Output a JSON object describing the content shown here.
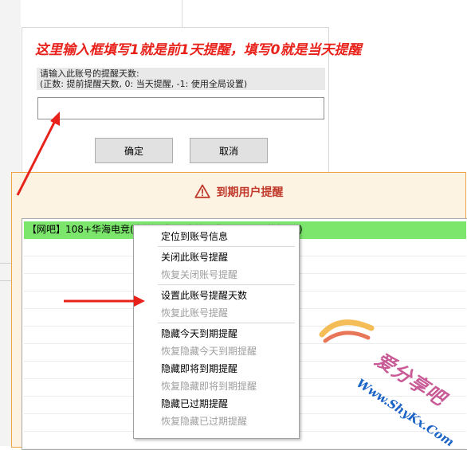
{
  "annotation": {
    "text": "这里输入框填写1就是前1天提醒，填写0就是当天提醒"
  },
  "input_dialog": {
    "prompt_line1": "请输入此账号的提醒天数:",
    "prompt_line2": "(正数: 提前提醒天数, 0: 当天提醒, -1: 使用全局设置)",
    "input_value": "",
    "ok_label": "确定",
    "cancel_label": "取消"
  },
  "expiry_window": {
    "title": "到期用户提醒",
    "warning_icon": "warning-triangle-icon",
    "title_color": "#c0392b",
    "rows": [
      {
        "text": "【网吧】108+华海电竞(电信网费)，电信网费2600元 (剩余1天)",
        "selected": true,
        "highlight_color": "#7be56c"
      }
    ]
  },
  "context_menu": {
    "groups": [
      [
        {
          "label": "定位到账号信息",
          "enabled": true
        }
      ],
      [
        {
          "label": "关闭此账号提醒",
          "enabled": true
        },
        {
          "label": "恢复关闭账号提醒",
          "enabled": false
        }
      ],
      [
        {
          "label": "设置此账号提醒天数",
          "enabled": true
        },
        {
          "label": "恢复此账号提醒",
          "enabled": false
        }
      ],
      [
        {
          "label": "隐藏今天到期提醒",
          "enabled": true
        },
        {
          "label": "恢复隐藏今天到期提醒",
          "enabled": false
        },
        {
          "label": "隐藏即将到期提醒",
          "enabled": true
        },
        {
          "label": "恢复隐藏即将到期提醒",
          "enabled": false
        },
        {
          "label": "隐藏已过期提醒",
          "enabled": true
        },
        {
          "label": "恢复隐藏已过期提醒",
          "enabled": false
        }
      ]
    ]
  },
  "watermark": {
    "cn": "爱分享吧",
    "url": "Www.ShyKx.Com"
  },
  "colors": {
    "annotation_red": "#e8221b",
    "arrow_red": "#e8221b",
    "window_border": "#f0a44a"
  }
}
